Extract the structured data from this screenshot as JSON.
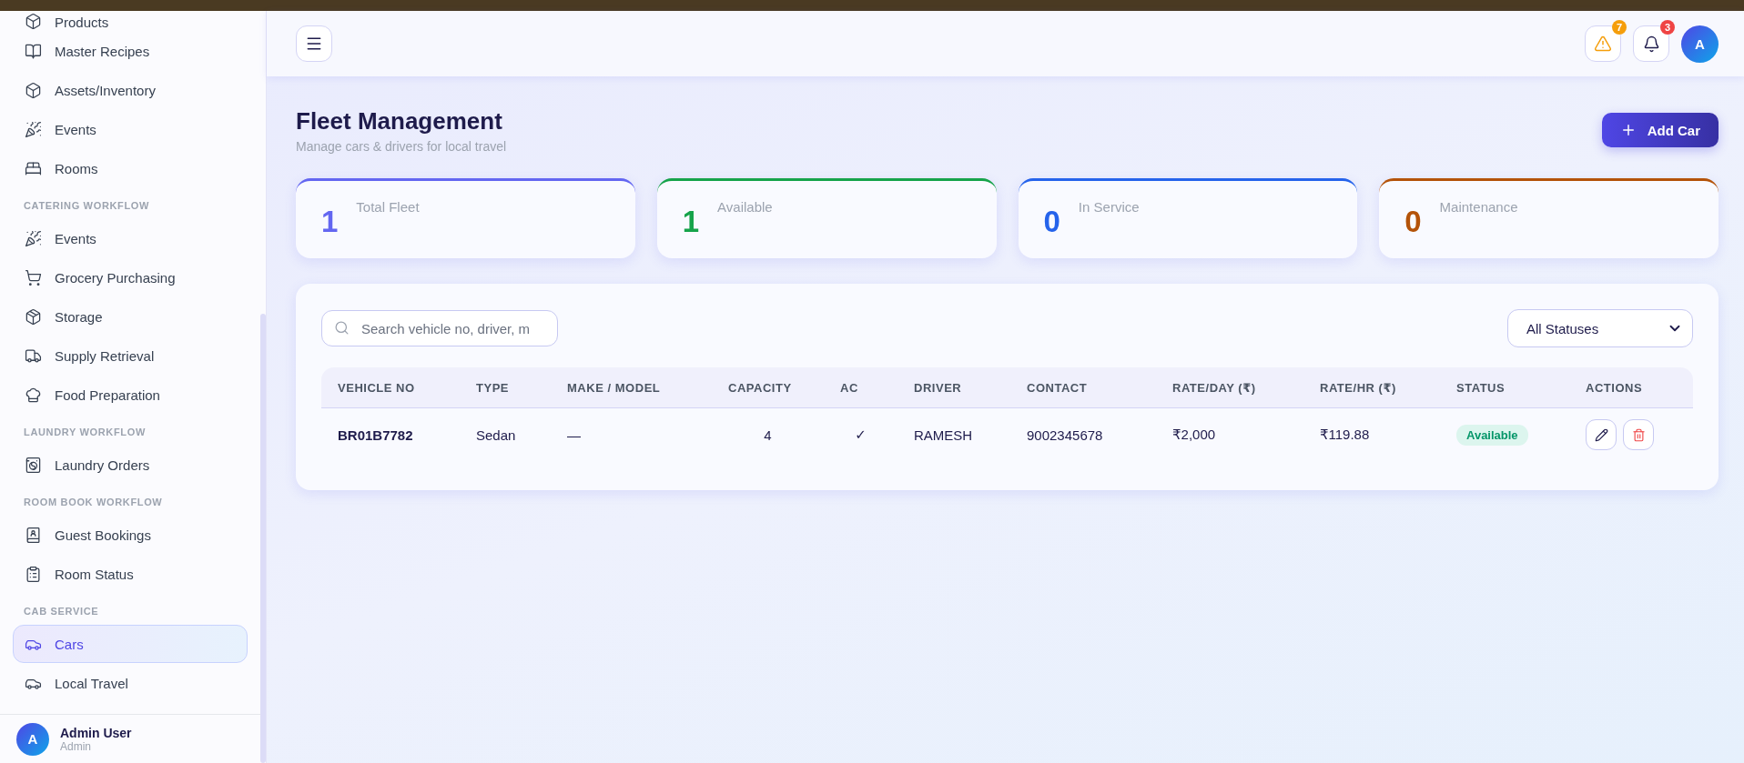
{
  "sidebar": {
    "sections": [
      {
        "items": [
          {
            "label": "Products",
            "selected": false
          },
          {
            "label": "Master Recipes",
            "selected": false
          },
          {
            "label": "Assets/Inventory",
            "selected": false
          },
          {
            "label": "Events",
            "selected": false
          },
          {
            "label": "Rooms",
            "selected": false
          }
        ]
      },
      {
        "heading": "CATERING WORKFLOW",
        "items": [
          {
            "label": "Events",
            "selected": false
          },
          {
            "label": "Grocery Purchasing",
            "selected": false
          },
          {
            "label": "Storage",
            "selected": false
          },
          {
            "label": "Supply Retrieval",
            "selected": false
          },
          {
            "label": "Food Preparation",
            "selected": false
          }
        ]
      },
      {
        "heading": "LAUNDRY WORKFLOW",
        "items": [
          {
            "label": "Laundry Orders",
            "selected": false
          }
        ]
      },
      {
        "heading": "ROOM BOOK WORKFLOW",
        "items": [
          {
            "label": "Guest Bookings",
            "selected": false
          },
          {
            "label": "Room Status",
            "selected": false
          }
        ]
      },
      {
        "heading": "CAB SERVICE",
        "items": [
          {
            "label": "Cars",
            "selected": true
          },
          {
            "label": "Local Travel",
            "selected": false
          }
        ]
      }
    ],
    "user": {
      "initial": "A",
      "name": "Admin User",
      "role": "Admin"
    }
  },
  "header": {
    "alerts": "7",
    "notifications": "3",
    "avatar": "A"
  },
  "page": {
    "title": "Fleet Management",
    "subtitle": "Manage cars & drivers for local travel",
    "add_button": "Add Car"
  },
  "stats": [
    {
      "value": "1",
      "label": "Total Fleet",
      "color": "#6366f1"
    },
    {
      "value": "1",
      "label": "Available",
      "color": "#16a34a"
    },
    {
      "value": "0",
      "label": "In Service",
      "color": "#2563eb"
    },
    {
      "value": "0",
      "label": "Maintenance",
      "color": "#b45309"
    }
  ],
  "filters": {
    "search": {
      "placeholder": "Search vehicle no, driver, m"
    },
    "status": "All Statuses"
  },
  "table": {
    "columns": [
      "VEHICLE NO",
      "TYPE",
      "MAKE / MODEL",
      "CAPACITY",
      "AC",
      "DRIVER",
      "CONTACT",
      "RATE/DAY (₹)",
      "RATE/HR (₹)",
      "STATUS",
      "ACTIONS"
    ],
    "rows": [
      {
        "vehicle_no": "BR01B7782",
        "type": "Sedan",
        "make_model": "—",
        "capacity": "4",
        "ac": "✓",
        "driver": "RAMESH",
        "contact": "9002345678",
        "rate_day": "₹2,000",
        "rate_hr": "₹119.88",
        "status": {
          "label": "Available",
          "kind": "available"
        }
      }
    ]
  }
}
